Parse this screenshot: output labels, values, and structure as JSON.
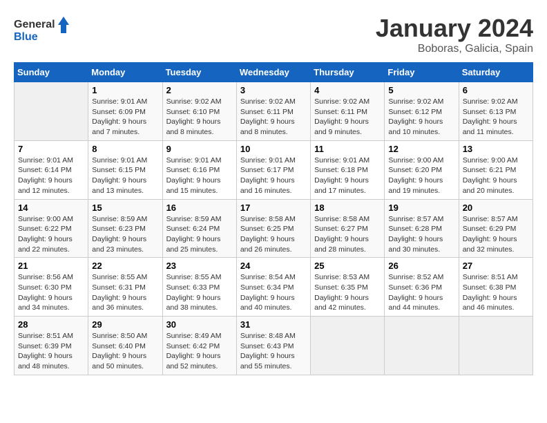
{
  "logo": {
    "general": "General",
    "blue": "Blue"
  },
  "title": {
    "month": "January 2024",
    "location": "Boboras, Galicia, Spain"
  },
  "weekdays": [
    "Sunday",
    "Monday",
    "Tuesday",
    "Wednesday",
    "Thursday",
    "Friday",
    "Saturday"
  ],
  "weeks": [
    [
      {
        "day": "",
        "empty": true
      },
      {
        "day": "1",
        "sunrise": "Sunrise: 9:01 AM",
        "sunset": "Sunset: 6:09 PM",
        "daylight": "Daylight: 9 hours and 7 minutes."
      },
      {
        "day": "2",
        "sunrise": "Sunrise: 9:02 AM",
        "sunset": "Sunset: 6:10 PM",
        "daylight": "Daylight: 9 hours and 8 minutes."
      },
      {
        "day": "3",
        "sunrise": "Sunrise: 9:02 AM",
        "sunset": "Sunset: 6:11 PM",
        "daylight": "Daylight: 9 hours and 8 minutes."
      },
      {
        "day": "4",
        "sunrise": "Sunrise: 9:02 AM",
        "sunset": "Sunset: 6:11 PM",
        "daylight": "Daylight: 9 hours and 9 minutes."
      },
      {
        "day": "5",
        "sunrise": "Sunrise: 9:02 AM",
        "sunset": "Sunset: 6:12 PM",
        "daylight": "Daylight: 9 hours and 10 minutes."
      },
      {
        "day": "6",
        "sunrise": "Sunrise: 9:02 AM",
        "sunset": "Sunset: 6:13 PM",
        "daylight": "Daylight: 9 hours and 11 minutes."
      }
    ],
    [
      {
        "day": "7",
        "sunrise": "Sunrise: 9:01 AM",
        "sunset": "Sunset: 6:14 PM",
        "daylight": "Daylight: 9 hours and 12 minutes."
      },
      {
        "day": "8",
        "sunrise": "Sunrise: 9:01 AM",
        "sunset": "Sunset: 6:15 PM",
        "daylight": "Daylight: 9 hours and 13 minutes."
      },
      {
        "day": "9",
        "sunrise": "Sunrise: 9:01 AM",
        "sunset": "Sunset: 6:16 PM",
        "daylight": "Daylight: 9 hours and 15 minutes."
      },
      {
        "day": "10",
        "sunrise": "Sunrise: 9:01 AM",
        "sunset": "Sunset: 6:17 PM",
        "daylight": "Daylight: 9 hours and 16 minutes."
      },
      {
        "day": "11",
        "sunrise": "Sunrise: 9:01 AM",
        "sunset": "Sunset: 6:18 PM",
        "daylight": "Daylight: 9 hours and 17 minutes."
      },
      {
        "day": "12",
        "sunrise": "Sunrise: 9:00 AM",
        "sunset": "Sunset: 6:20 PM",
        "daylight": "Daylight: 9 hours and 19 minutes."
      },
      {
        "day": "13",
        "sunrise": "Sunrise: 9:00 AM",
        "sunset": "Sunset: 6:21 PM",
        "daylight": "Daylight: 9 hours and 20 minutes."
      }
    ],
    [
      {
        "day": "14",
        "sunrise": "Sunrise: 9:00 AM",
        "sunset": "Sunset: 6:22 PM",
        "daylight": "Daylight: 9 hours and 22 minutes."
      },
      {
        "day": "15",
        "sunrise": "Sunrise: 8:59 AM",
        "sunset": "Sunset: 6:23 PM",
        "daylight": "Daylight: 9 hours and 23 minutes."
      },
      {
        "day": "16",
        "sunrise": "Sunrise: 8:59 AM",
        "sunset": "Sunset: 6:24 PM",
        "daylight": "Daylight: 9 hours and 25 minutes."
      },
      {
        "day": "17",
        "sunrise": "Sunrise: 8:58 AM",
        "sunset": "Sunset: 6:25 PM",
        "daylight": "Daylight: 9 hours and 26 minutes."
      },
      {
        "day": "18",
        "sunrise": "Sunrise: 8:58 AM",
        "sunset": "Sunset: 6:27 PM",
        "daylight": "Daylight: 9 hours and 28 minutes."
      },
      {
        "day": "19",
        "sunrise": "Sunrise: 8:57 AM",
        "sunset": "Sunset: 6:28 PM",
        "daylight": "Daylight: 9 hours and 30 minutes."
      },
      {
        "day": "20",
        "sunrise": "Sunrise: 8:57 AM",
        "sunset": "Sunset: 6:29 PM",
        "daylight": "Daylight: 9 hours and 32 minutes."
      }
    ],
    [
      {
        "day": "21",
        "sunrise": "Sunrise: 8:56 AM",
        "sunset": "Sunset: 6:30 PM",
        "daylight": "Daylight: 9 hours and 34 minutes."
      },
      {
        "day": "22",
        "sunrise": "Sunrise: 8:55 AM",
        "sunset": "Sunset: 6:31 PM",
        "daylight": "Daylight: 9 hours and 36 minutes."
      },
      {
        "day": "23",
        "sunrise": "Sunrise: 8:55 AM",
        "sunset": "Sunset: 6:33 PM",
        "daylight": "Daylight: 9 hours and 38 minutes."
      },
      {
        "day": "24",
        "sunrise": "Sunrise: 8:54 AM",
        "sunset": "Sunset: 6:34 PM",
        "daylight": "Daylight: 9 hours and 40 minutes."
      },
      {
        "day": "25",
        "sunrise": "Sunrise: 8:53 AM",
        "sunset": "Sunset: 6:35 PM",
        "daylight": "Daylight: 9 hours and 42 minutes."
      },
      {
        "day": "26",
        "sunrise": "Sunrise: 8:52 AM",
        "sunset": "Sunset: 6:36 PM",
        "daylight": "Daylight: 9 hours and 44 minutes."
      },
      {
        "day": "27",
        "sunrise": "Sunrise: 8:51 AM",
        "sunset": "Sunset: 6:38 PM",
        "daylight": "Daylight: 9 hours and 46 minutes."
      }
    ],
    [
      {
        "day": "28",
        "sunrise": "Sunrise: 8:51 AM",
        "sunset": "Sunset: 6:39 PM",
        "daylight": "Daylight: 9 hours and 48 minutes."
      },
      {
        "day": "29",
        "sunrise": "Sunrise: 8:50 AM",
        "sunset": "Sunset: 6:40 PM",
        "daylight": "Daylight: 9 hours and 50 minutes."
      },
      {
        "day": "30",
        "sunrise": "Sunrise: 8:49 AM",
        "sunset": "Sunset: 6:42 PM",
        "daylight": "Daylight: 9 hours and 52 minutes."
      },
      {
        "day": "31",
        "sunrise": "Sunrise: 8:48 AM",
        "sunset": "Sunset: 6:43 PM",
        "daylight": "Daylight: 9 hours and 55 minutes."
      },
      {
        "day": "",
        "empty": true
      },
      {
        "day": "",
        "empty": true
      },
      {
        "day": "",
        "empty": true
      }
    ]
  ]
}
